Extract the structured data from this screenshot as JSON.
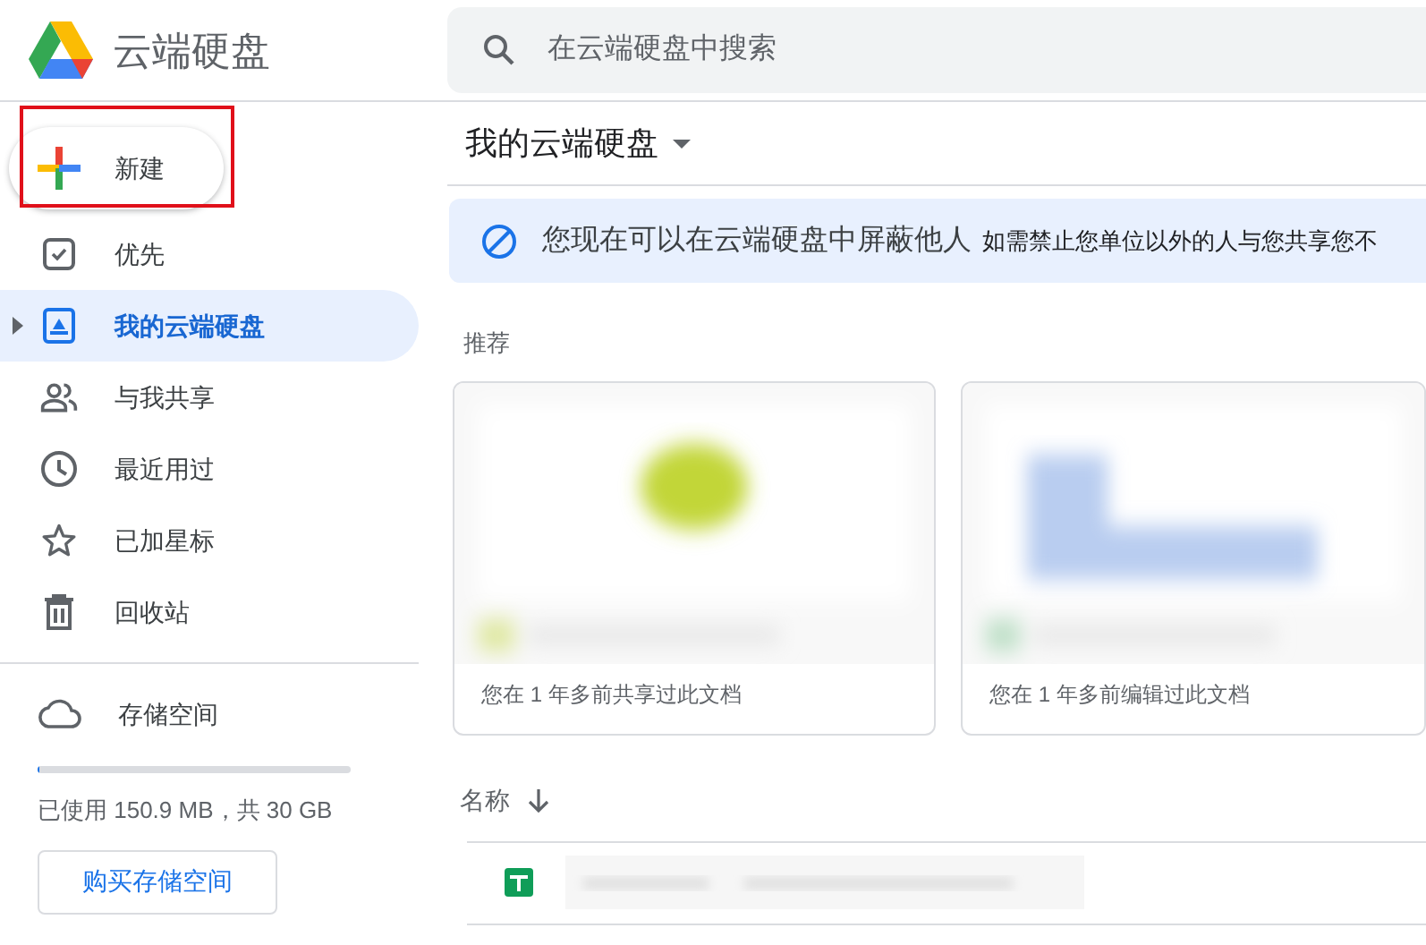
{
  "header": {
    "app_title": "云端硬盘",
    "search": {
      "placeholder": "在云端硬盘中搜索"
    }
  },
  "sidebar": {
    "new_button": {
      "label": "新建",
      "highlighted": true
    },
    "items": [
      {
        "kind": "priority",
        "label": "优先",
        "selected": false
      },
      {
        "kind": "drive",
        "label": "我的云端硬盘",
        "selected": true
      },
      {
        "kind": "shared",
        "label": "与我共享",
        "selected": false
      },
      {
        "kind": "recent",
        "label": "最近用过",
        "selected": false
      },
      {
        "kind": "starred",
        "label": "已加星标",
        "selected": false
      },
      {
        "kind": "trash",
        "label": "回收站",
        "selected": false
      }
    ],
    "storage": {
      "label": "存储空间",
      "level": 0.005,
      "usage": "已使用 150.9 MB，共 30 GB",
      "buy_button": "购买存储空间"
    }
  },
  "main": {
    "title": "我的云端硬盘",
    "banner": {
      "title": "您现在可以在云端硬盘中屏蔽他人",
      "text": "如需禁止您单位以外的人与您共享您不"
    },
    "suggested": {
      "heading": "推荐",
      "cards": [
        {
          "kind": "picture",
          "caption": "您在 1 年多前共享过此文档"
        },
        {
          "kind": "picture",
          "caption": "您在 1 年多前编辑过此文档"
        }
      ]
    },
    "list": {
      "column_1": "名称",
      "rows": [
        {
          "kind": "spreadsheet"
        }
      ]
    }
  }
}
